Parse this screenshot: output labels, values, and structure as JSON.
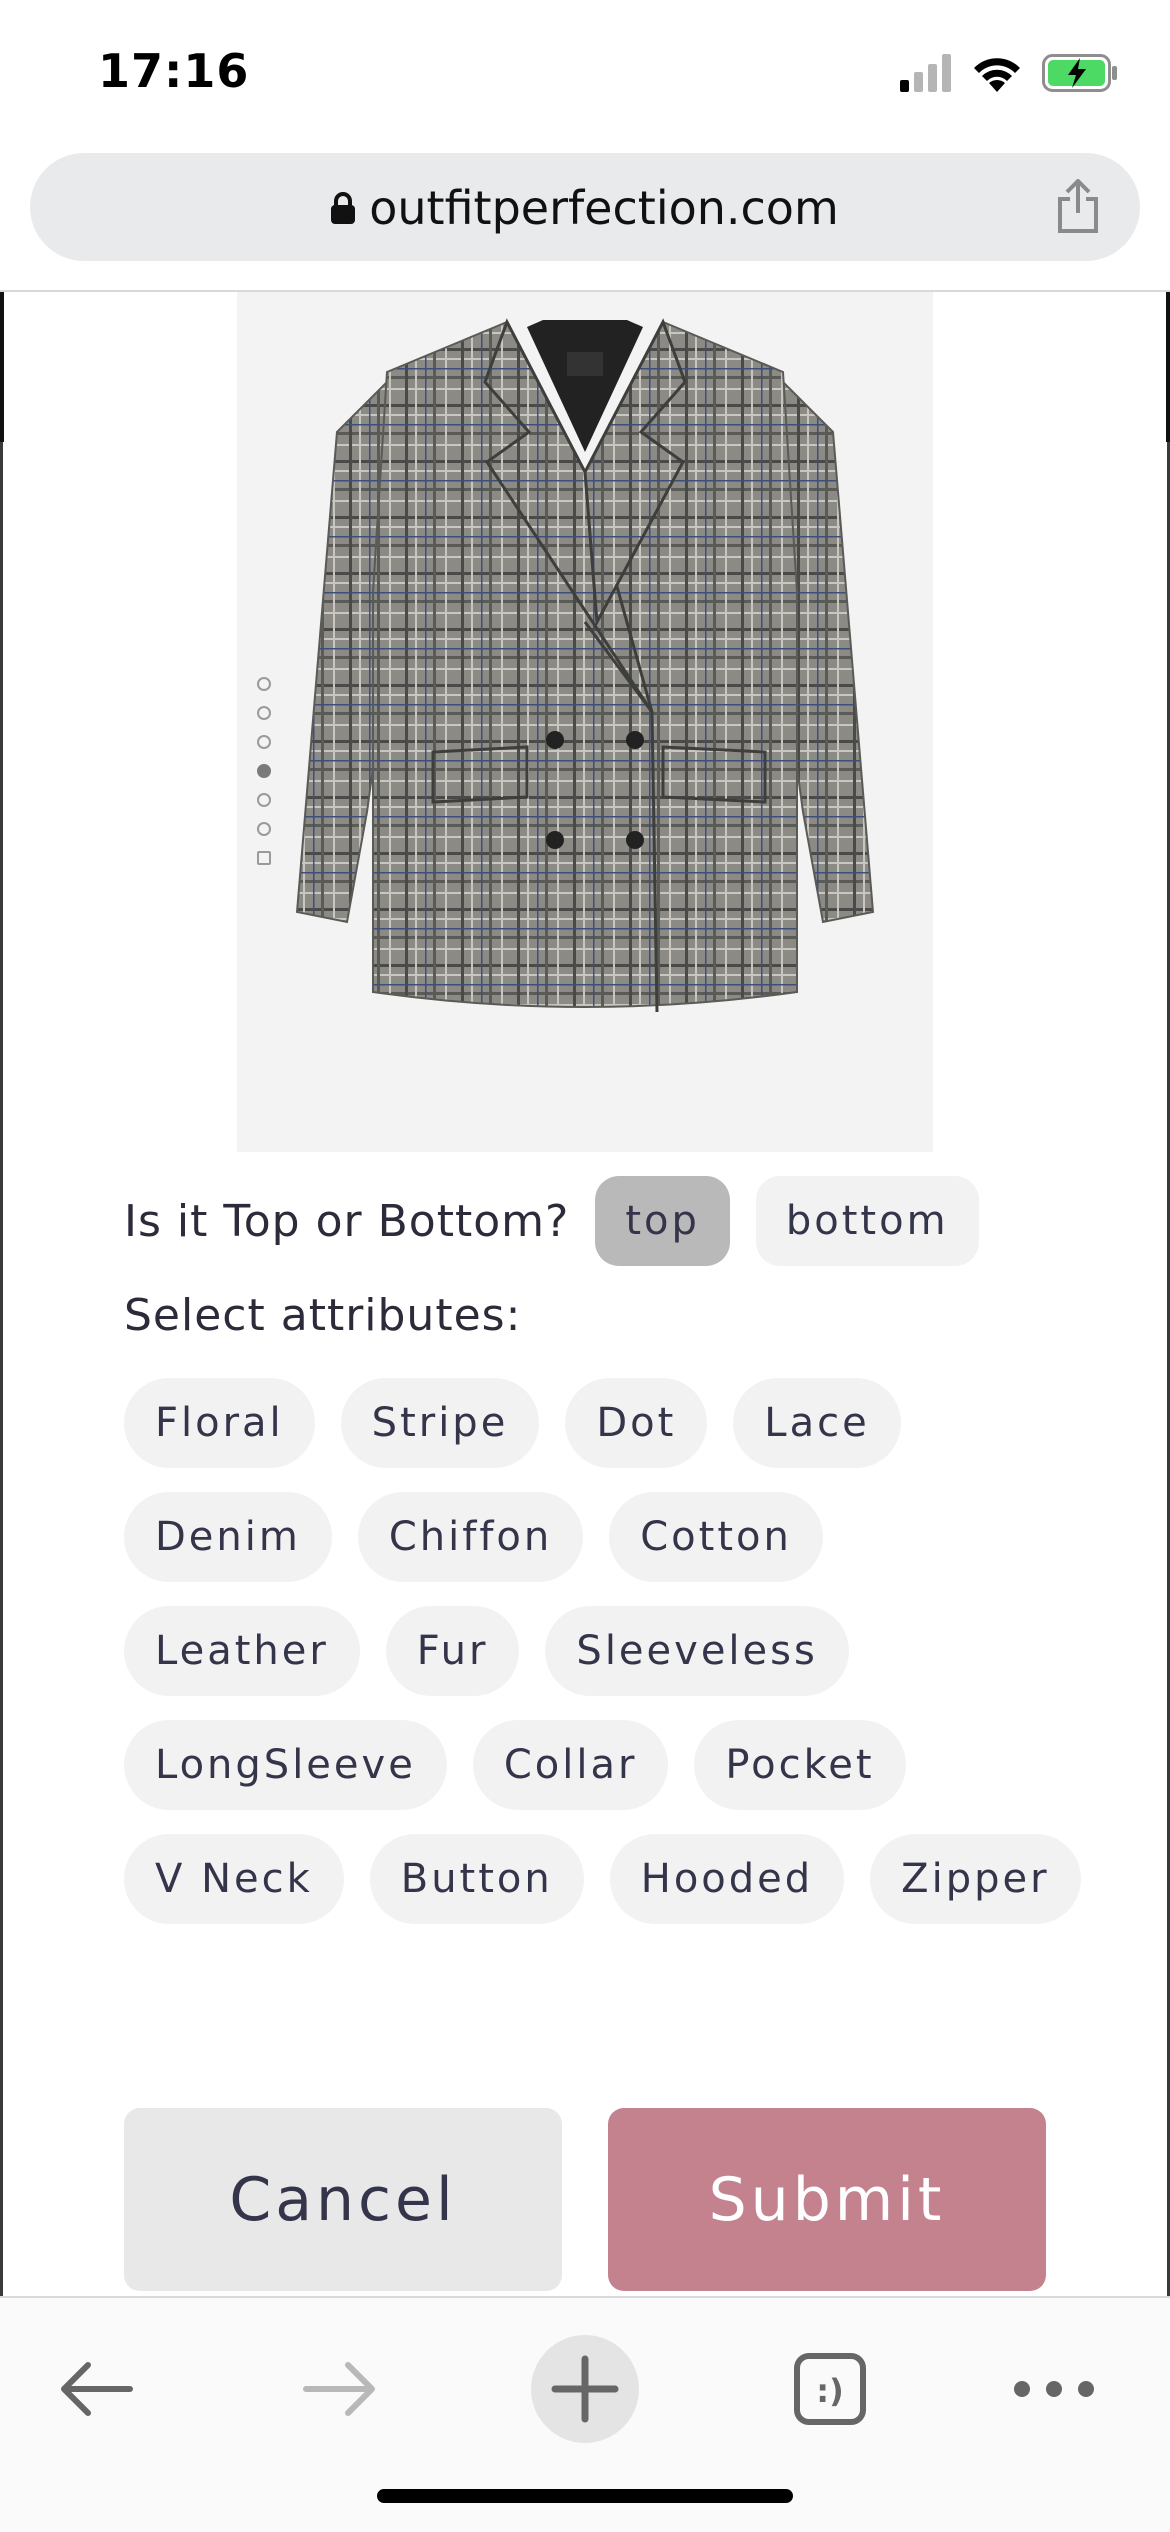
{
  "status_bar": {
    "time": "17:16",
    "icons": [
      "signal-icon",
      "wifi-icon",
      "battery-charging-icon"
    ],
    "battery_color": "#4cd964"
  },
  "browser": {
    "url": "outfitperfection.com",
    "lock_icon": "lock-icon",
    "share_icon": "share-icon"
  },
  "product": {
    "image_alt_icon": "plaid-blazer-image",
    "carousel": {
      "total": 7,
      "active_index": 3
    }
  },
  "question": {
    "label": "Is it Top or Bottom?",
    "options": [
      {
        "label": "top",
        "selected": true
      },
      {
        "label": "bottom",
        "selected": false
      }
    ]
  },
  "attributes": {
    "label": "Select attributes:",
    "chips": [
      "Floral",
      "Stripe",
      "Dot",
      "Lace",
      "Denim",
      "Chiffon",
      "Cotton",
      "Leather",
      "Fur",
      "Sleeveless",
      "LongSleeve",
      "Collar",
      "Pocket",
      "V Neck",
      "Button",
      "Hooded",
      "Zipper"
    ]
  },
  "actions": {
    "cancel_label": "Cancel",
    "submit_label": "Submit",
    "submit_color": "#c4828e"
  },
  "toolbar": {
    "items": [
      "back-arrow-icon",
      "forward-arrow-icon",
      "new-tab-plus-icon",
      "tabs-icon",
      "more-icon"
    ],
    "tabs_glyph": ":)"
  }
}
